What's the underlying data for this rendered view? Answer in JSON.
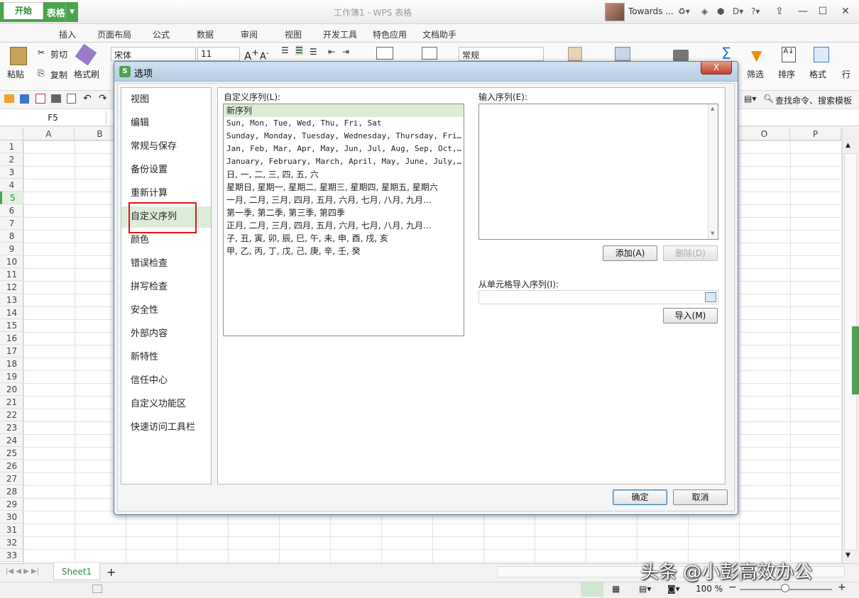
{
  "app": {
    "name": "WPS 表格",
    "window_title": "工作簿1 - WPS 表格",
    "user": "Towards ...",
    "accent": "#4ca34f"
  },
  "ribbon_tabs": [
    "开始",
    "插入",
    "页面布局",
    "公式",
    "数据",
    "审阅",
    "视图",
    "开发工具",
    "特色应用",
    "文档助手"
  ],
  "ribbon": {
    "paste": "粘贴",
    "cut": "剪切",
    "copy": "复制",
    "format_painter": "格式刷",
    "font": "宋体",
    "size": "11",
    "number_format": "常规",
    "filter": "筛选",
    "sort": "排序",
    "format": "格式",
    "row": "行",
    "search": "查找命令、搜索模板"
  },
  "name_box": "F5",
  "columns": [
    "A",
    "B",
    "O",
    "P"
  ],
  "rows": [
    "1",
    "2",
    "3",
    "4",
    "5",
    "6",
    "7",
    "8",
    "9",
    "10",
    "11",
    "12",
    "13",
    "14",
    "15",
    "16",
    "17",
    "18",
    "19",
    "20",
    "21",
    "22",
    "23",
    "24",
    "25",
    "26",
    "27",
    "28",
    "29",
    "30",
    "31",
    "32",
    "33"
  ],
  "sheet_tab": "Sheet1",
  "status": {
    "zoom": "100 %"
  },
  "dialog": {
    "title": "选项",
    "close": "X",
    "nav": [
      "视图",
      "编辑",
      "常规与保存",
      "备份设置",
      "重新计算",
      "自定义序列",
      "颜色",
      "错误检查",
      "拼写检查",
      "安全性",
      "外部内容",
      "新特性",
      "信任中心",
      "自定义功能区",
      "快速访问工具栏"
    ],
    "active_nav": "自定义序列",
    "custom_list_label": "自定义序列(L):",
    "custom_lists": [
      "新序列",
      "Sun, Mon, Tue, Wed, Thu, Fri, Sat",
      "Sunday, Monday, Tuesday, Wednesday, Thursday, Friday…",
      "Jan, Feb, Mar, Apr, May, Jun, Jul, Aug, Sep, Oct, No…",
      "January, February, March, April, May, June, July, Au…",
      "日, 一, 二, 三, 四, 五, 六",
      "星期日, 星期一, 星期二, 星期三, 星期四, 星期五, 星期六",
      "一月, 二月, 三月, 四月, 五月, 六月, 七月, 八月, 九月…",
      "第一季, 第二季, 第三季, 第四季",
      "正月, 二月, 三月, 四月, 五月, 六月, 七月, 八月, 九月…",
      "子, 丑, 寅, 卯, 辰, 巳, 午, 未, 申, 酉, 戌, 亥",
      "甲, 乙, 丙, 丁, 戊, 己, 庚, 辛, 壬, 癸"
    ],
    "input_label": "输入序列(E):",
    "add_button": "添加(A)",
    "delete_button": "删除(D)",
    "import_label": "从单元格导入序列(I):",
    "import_button": "导入(M)",
    "ok_button": "确定",
    "cancel_button": "取消"
  },
  "watermark": "头条 @小彭高效办公"
}
